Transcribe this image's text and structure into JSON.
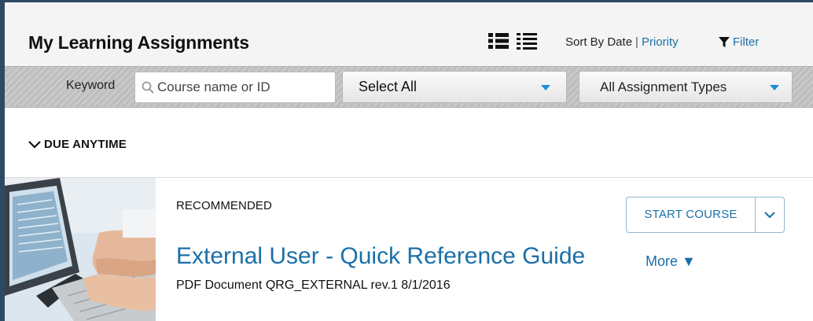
{
  "header": {
    "title": "My Learning Assignments",
    "sort_by": "Sort By Date",
    "separator": "|",
    "priority": "Priority",
    "filter": "Filter"
  },
  "filters": {
    "keyword_label": "Keyword",
    "keyword_placeholder": "Course name or ID",
    "keyword_value": "",
    "status_dropdown": "Select All",
    "type_dropdown": "All Assignment Types"
  },
  "section": {
    "title": "DUE ANYTIME"
  },
  "course": {
    "tag": "RECOMMENDED",
    "title": "External User - Quick Reference Guide",
    "more": "More ▼",
    "meta": "PDF Document QRG_EXTERNAL rev.1 8/1/2016",
    "action": "START COURSE"
  },
  "colors": {
    "accent": "#1b6fa8",
    "caret": "#1b8fd6",
    "frame": "#2f4a63"
  },
  "icons": [
    "list-view-icon",
    "detail-view-icon",
    "filter-icon",
    "search-icon",
    "chevron-down-icon"
  ]
}
